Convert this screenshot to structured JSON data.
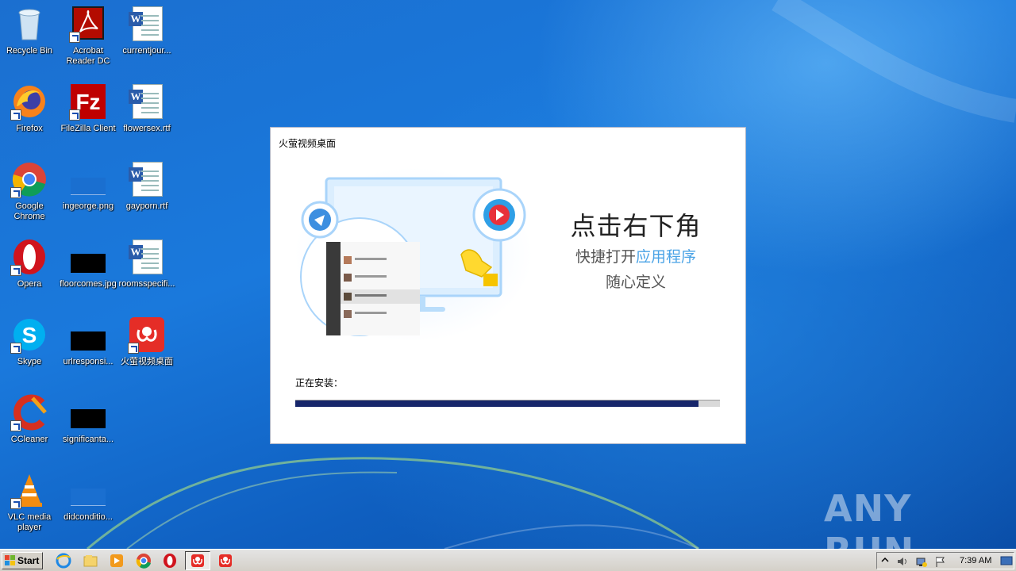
{
  "desktop": {
    "icons": [
      {
        "label": "Recycle Bin",
        "icon": "recycle-bin-icon"
      },
      {
        "label": "Acrobat Reader DC",
        "icon": "acrobat-reader-icon"
      },
      {
        "label": "currentjour...",
        "icon": "word-document-icon"
      },
      {
        "label": "Firefox",
        "icon": "firefox-icon"
      },
      {
        "label": "FileZilla Client",
        "icon": "filezilla-icon"
      },
      {
        "label": "flowersex.rtf",
        "icon": "word-document-icon"
      },
      {
        "label": "Google Chrome",
        "icon": "chrome-icon"
      },
      {
        "label": "ingeorge.png",
        "icon": "image-file-icon"
      },
      {
        "label": "gayporn.rtf",
        "icon": "word-document-icon"
      },
      {
        "label": "Opera",
        "icon": "opera-icon"
      },
      {
        "label": "floorcomes.jpg",
        "icon": "image-file-icon"
      },
      {
        "label": "roomsspecifi...",
        "icon": "word-document-icon"
      },
      {
        "label": "Skype",
        "icon": "skype-icon"
      },
      {
        "label": "urlresponsi...",
        "icon": "image-file-icon"
      },
      {
        "label": "火萤视频桌面",
        "icon": "firefly-app-icon"
      },
      {
        "label": "CCleaner",
        "icon": "ccleaner-icon"
      },
      {
        "label": "significanta...",
        "icon": "image-file-icon"
      },
      {
        "label": "VLC media player",
        "icon": "vlc-icon"
      },
      {
        "label": "didconditio...",
        "icon": "image-file-icon"
      }
    ]
  },
  "installer": {
    "title": "火萤视频桌面",
    "promo_line1": "点击右下角",
    "promo_line2_prefix": "快捷打开",
    "promo_line2_highlight": "应用程序",
    "promo_line3": "随心定义",
    "status_label": "正在安装：",
    "progress": 0.95
  },
  "watermark": {
    "text": "ANY RUN"
  },
  "taskbar": {
    "start_label": "Start",
    "pinned": [
      "ie-icon",
      "explorer-icon",
      "media-player-icon",
      "chrome-icon",
      "opera-icon",
      "firefly-installer-icon",
      "firefly-app-icon"
    ],
    "clock": "7:39 AM"
  }
}
